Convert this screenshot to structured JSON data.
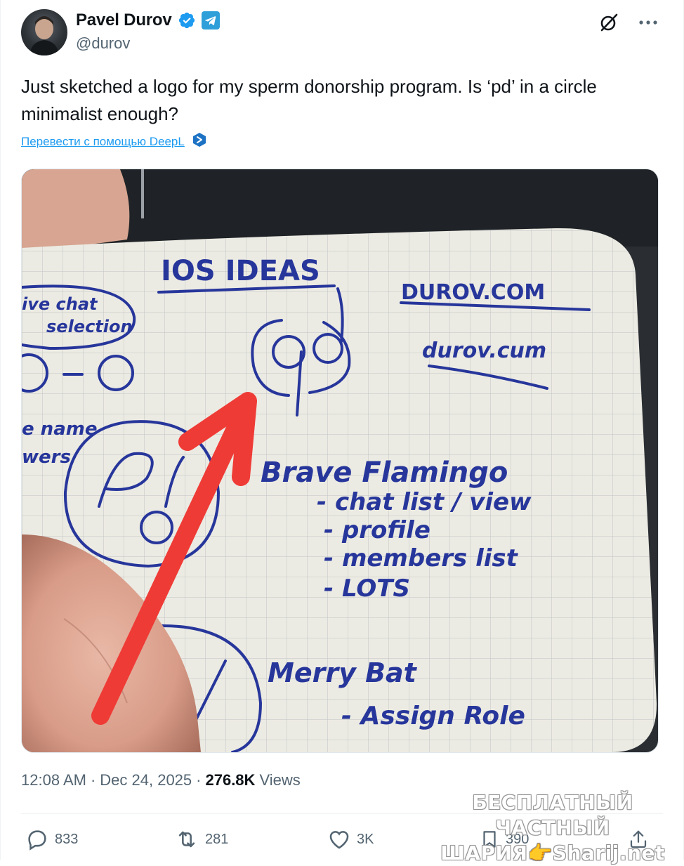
{
  "author": {
    "display_name": "Pavel Durov",
    "handle": "@durov",
    "verified_icon": "verified-badge-icon",
    "affiliate_icon": "telegram-icon"
  },
  "header_actions": {
    "grok_icon": "grok-icon",
    "more_icon": "more-icon"
  },
  "tweet": {
    "text": "Just sketched a logo for my sperm donorship program. Is ‘pd’ in a circle minimalist enough?",
    "translate_label": "Перевести с помощью DeepL",
    "translate_icon": "deepl-icon"
  },
  "media": {
    "notebook_heading": "IOS IDEAS",
    "line_durov_com": "DUROV.COM",
    "line_durov_cum": "durov.cum",
    "line_chat_selection_1": "ive chat",
    "line_chat_selection_2": "selection",
    "line_rename_1": "e name",
    "line_rename_2": "wers",
    "line_brave": "Brave Flamingo",
    "line_chat_list": "- chat list / view",
    "line_profile": "- profile",
    "line_members": "- members list",
    "line_lots": "- LOTS",
    "line_merry": "Merry Bat",
    "line_assign": "- Assign Role"
  },
  "meta": {
    "time": "12:08 AM",
    "separator": "·",
    "date": "Dec 24, 2025",
    "separator2": "·",
    "views_count": "276.8K",
    "views_label": "Views"
  },
  "actions": {
    "replies": "833",
    "reposts": "281",
    "likes": "3K",
    "bookmarks": "390"
  },
  "watermark": {
    "line1": "БЕСПЛАТНЫЙ ЧАСТНЫЙ",
    "line2": "ШАРИЯ👉Sharij.net"
  },
  "colors": {
    "accent": "#1d9bf0",
    "muted": "#536471",
    "ink": "#27369b",
    "arrow": "#ef3b36"
  }
}
